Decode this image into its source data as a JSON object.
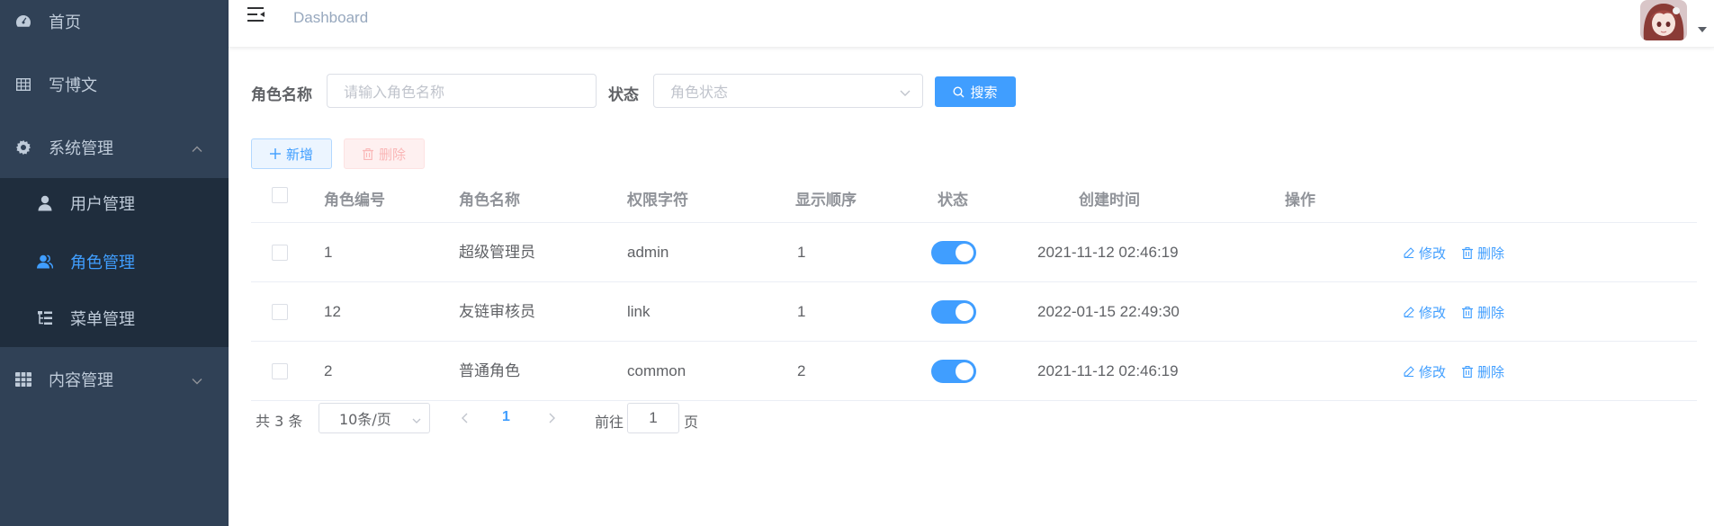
{
  "sidebar": {
    "items": [
      {
        "label": "首页",
        "icon": "dashboard-icon"
      },
      {
        "label": "写博文",
        "icon": "table-icon"
      },
      {
        "label": "系统管理",
        "icon": "gear-icon",
        "expanded": true
      },
      {
        "label": "内容管理",
        "icon": "grid-icon",
        "expanded": false
      }
    ],
    "submenu": [
      {
        "label": "用户管理",
        "icon": "user-icon"
      },
      {
        "label": "角色管理",
        "icon": "peoples-icon",
        "active": true
      },
      {
        "label": "菜单管理",
        "icon": "tree-table-icon"
      }
    ]
  },
  "navbar": {
    "breadcrumb": "Dashboard"
  },
  "search": {
    "role_name_label": "角色名称",
    "role_name_placeholder": "请输入角色名称",
    "status_label": "状态",
    "status_placeholder": "角色状态",
    "search_button": "搜索"
  },
  "toolbar": {
    "add_button": "新增",
    "delete_button": "删除"
  },
  "table": {
    "headers": [
      "角色编号",
      "角色名称",
      "权限字符",
      "显示顺序",
      "状态",
      "创建时间",
      "操作"
    ],
    "rows": [
      {
        "id": "1",
        "name": "超级管理员",
        "key": "admin",
        "sort": "1",
        "status": true,
        "created": "2021-11-12 02:46:19"
      },
      {
        "id": "12",
        "name": "友链审核员",
        "key": "link",
        "sort": "1",
        "status": true,
        "created": "2022-01-15 22:49:30"
      },
      {
        "id": "2",
        "name": "普通角色",
        "key": "common",
        "sort": "2",
        "status": true,
        "created": "2021-11-12 02:46:19"
      }
    ],
    "edit_label": "修改",
    "delete_label": "删除"
  },
  "pagination": {
    "total_text": "共 3 条",
    "page_size": "10条/页",
    "current_page": "1",
    "goto_prefix": "前往",
    "goto_value": "1",
    "goto_suffix": "页"
  },
  "colors": {
    "sidebar_bg": "#304156",
    "submenu_bg": "#1f2d3d",
    "sidebar_text": "#bfcbd9",
    "accent": "#409eff"
  }
}
